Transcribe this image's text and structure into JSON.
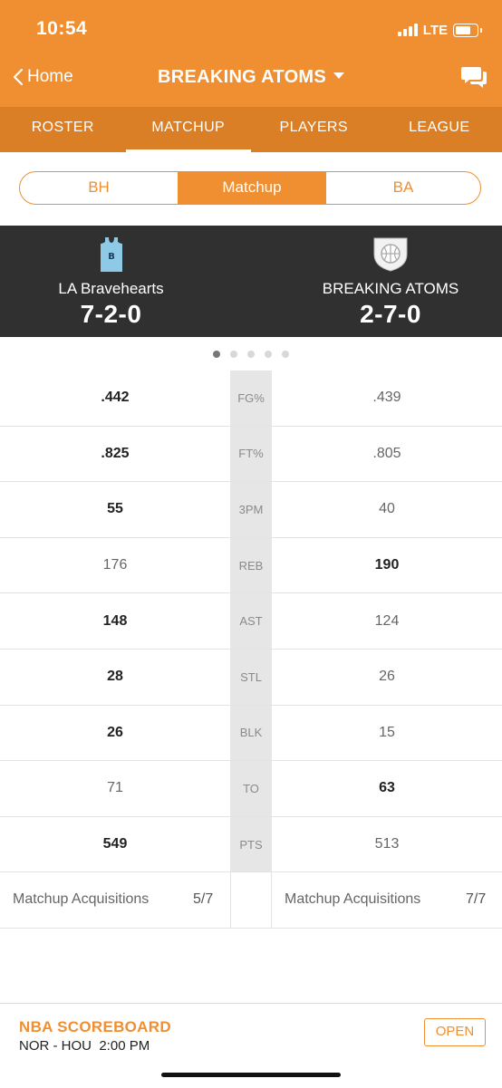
{
  "status_bar": {
    "time": "10:54",
    "network": "LTE"
  },
  "nav": {
    "back_label": "Home",
    "team_title": "BREAKING ATOMS"
  },
  "tabs": [
    {
      "label": "ROSTER"
    },
    {
      "label": "MATCHUP"
    },
    {
      "label": "PLAYERS"
    },
    {
      "label": "LEAGUE"
    }
  ],
  "active_tab": "MATCHUP",
  "segment": {
    "left": "BH",
    "middle": "Matchup",
    "right": "BA"
  },
  "teams": {
    "left": {
      "name": "LA Bravehearts",
      "record": "7-2-0",
      "logo_letter": "B"
    },
    "right": {
      "name": "BREAKING ATOMS",
      "record": "2-7-0"
    }
  },
  "pager": {
    "count": 5,
    "active_index": 0
  },
  "stats": [
    {
      "category": "FG%",
      "left": ".442",
      "right": ".439",
      "winner": "left"
    },
    {
      "category": "FT%",
      "left": ".825",
      "right": ".805",
      "winner": "left"
    },
    {
      "category": "3PM",
      "left": "55",
      "right": "40",
      "winner": "left"
    },
    {
      "category": "REB",
      "left": "176",
      "right": "190",
      "winner": "right"
    },
    {
      "category": "AST",
      "left": "148",
      "right": "124",
      "winner": "left"
    },
    {
      "category": "STL",
      "left": "28",
      "right": "26",
      "winner": "left"
    },
    {
      "category": "BLK",
      "left": "26",
      "right": "15",
      "winner": "left"
    },
    {
      "category": "TO",
      "left": "71",
      "right": "63",
      "winner": "right"
    },
    {
      "category": "PTS",
      "left": "549",
      "right": "513",
      "winner": "left"
    }
  ],
  "acquisitions": {
    "label": "Matchup Acquisitions",
    "left_value": "5/7",
    "right_value": "7/7"
  },
  "scoreboard": {
    "title": "NBA SCOREBOARD",
    "game": "NOR - HOU",
    "time": "2:00 PM",
    "open_label": "OPEN"
  },
  "colors": {
    "accent": "#ef8f31",
    "tab_bar": "#db7f26",
    "banner": "#303030",
    "jersey": "#8ecae6"
  }
}
